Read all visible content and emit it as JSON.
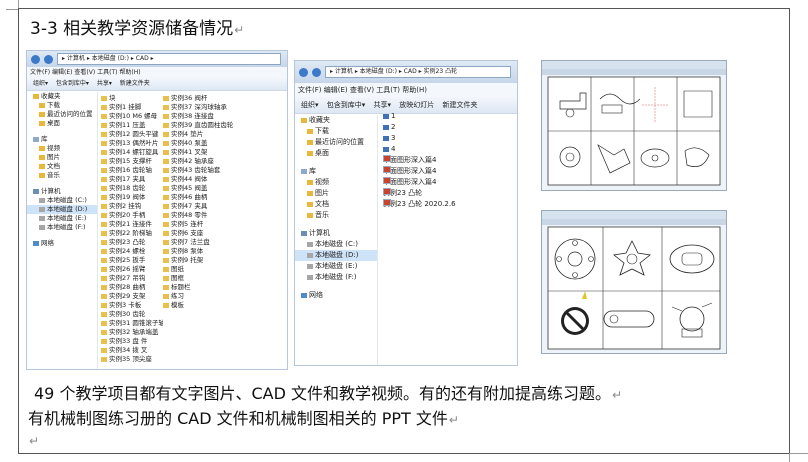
{
  "title": "3-3 相关教学资源储备情况",
  "paragraph_mark": "↵",
  "paragraphs": [
    "49 个教学项目都有文字图片、CAD 文件和教学视频。有的还有附加提高练习题。",
    "有机械制图练习册的 CAD 文件和机械制图相关的 PPT 文件",
    ""
  ],
  "explorer1": {
    "address": "▸ 计算机 ▸ 本地磁盘 (D:) ▸ CAD ▸",
    "menu": "文件(F)  编辑(E)  查看(V)  工具(T)  帮助(H)",
    "commands": "组织▾ 包含到库中▾ 共享▾ 新建文件夹",
    "nav": [
      "收藏夹",
      "下载",
      "最近访问的位置",
      "桌面",
      "库",
      "视频",
      "图片",
      "文档",
      "音乐",
      "计算机",
      "本地磁盘 (C:)",
      "本地磁盘 (D:)",
      "本地磁盘 (E:)",
      "本地磁盘 (F:)",
      "网络"
    ],
    "files": [
      "块",
      "实例1 挂脚",
      "实例10 M6 螺母",
      "实例11 压盖",
      "实例12 圆头平键",
      "实例13 偶然叶片",
      "实例14 螺钉旋具",
      "实例15 支撑杆",
      "实例16 齿轮轴",
      "实例17 夹具",
      "实例18 齿轮",
      "实例19 阀体",
      "实例2 挂钩",
      "实例20 手柄",
      "实例21 连接件",
      "实例22 阶梯轴",
      "实例23 凸轮",
      "实例24 螺栓",
      "实例25 扳手",
      "实例26 摇臂",
      "实例27 吊钩",
      "实例28 曲柄",
      "实例29 支架",
      "实例3 卡板",
      "实例30 齿轮",
      "实例31 圆锥滚子轴承",
      "实例32 轴承端盖",
      "实例33 盘 件",
      "实例34 拨 叉",
      "实例35 顶尖座",
      "实例36 阀杆",
      "实例37 深沟球轴承",
      "实例38 连接盘",
      "实例39 直齿圆柱齿轮",
      "实例4 垫片",
      "实例40 泵盖",
      "实例41 叉架",
      "实例42 轴承座",
      "实例43 齿轮轴套",
      "实例44 阀体",
      "实例45 阀盖",
      "实例46 曲柄",
      "实例47 夹具",
      "实例48 零件",
      "实例5 连杆",
      "实例6 支座",
      "实例7 法兰盘",
      "实例8 泵体",
      "实例9 托架",
      "图纸",
      "图框",
      "标题栏",
      "练习",
      "模板"
    ]
  },
  "explorer2": {
    "address": "▸ 计算机 ▸ 本地磁盘 (D:) ▸ CAD ▸ 实例23 凸轮",
    "menu": "文件(F)  编辑(E)  查看(V)  工具(T)  帮助(H)",
    "commands": "组织▾ 包含到库中▾ 共享▾ 放映幻灯片 新建文件夹",
    "nav": [
      "收藏夹",
      "下载",
      "最近访问的位置",
      "桌面",
      "库",
      "视频",
      "图片",
      "文档",
      "音乐",
      "计算机",
      "本地磁盘 (C:)",
      "本地磁盘 (D:)",
      "本地磁盘 (E:)",
      "本地磁盘 (F:)",
      "网络"
    ],
    "files": [
      "1",
      "2",
      "3",
      "4",
      "平面图形深入篇4",
      "平面图形深入篇4",
      "平面图形深入篇4",
      "实例23 凸轮",
      "实例23 凸轮 2020.2.6"
    ]
  }
}
